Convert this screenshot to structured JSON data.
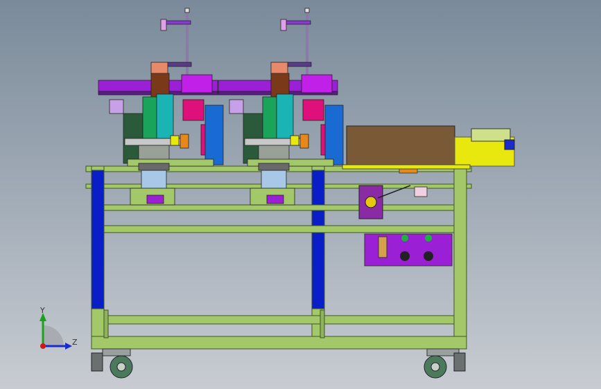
{
  "view": {
    "background_top": "#7a8a9a",
    "background_bottom": "#c8ccd2"
  },
  "triad": {
    "y_label": "Y",
    "z_label": "Z",
    "y_color": "#1aa31a",
    "z_color": "#1a2acc",
    "origin_color": "#cc1a1a"
  },
  "colors": {
    "frame": "#a3c86a",
    "frame_dark": "#5b7a2e",
    "leg_blue": "#0a1ec8",
    "purple": "#9b1fd4",
    "magenta": "#e0107a",
    "cabinet": "#7a5a36",
    "yellow": "#e8e80e",
    "teal": "#1ab4b4",
    "wheel": "#4a7a5a"
  }
}
